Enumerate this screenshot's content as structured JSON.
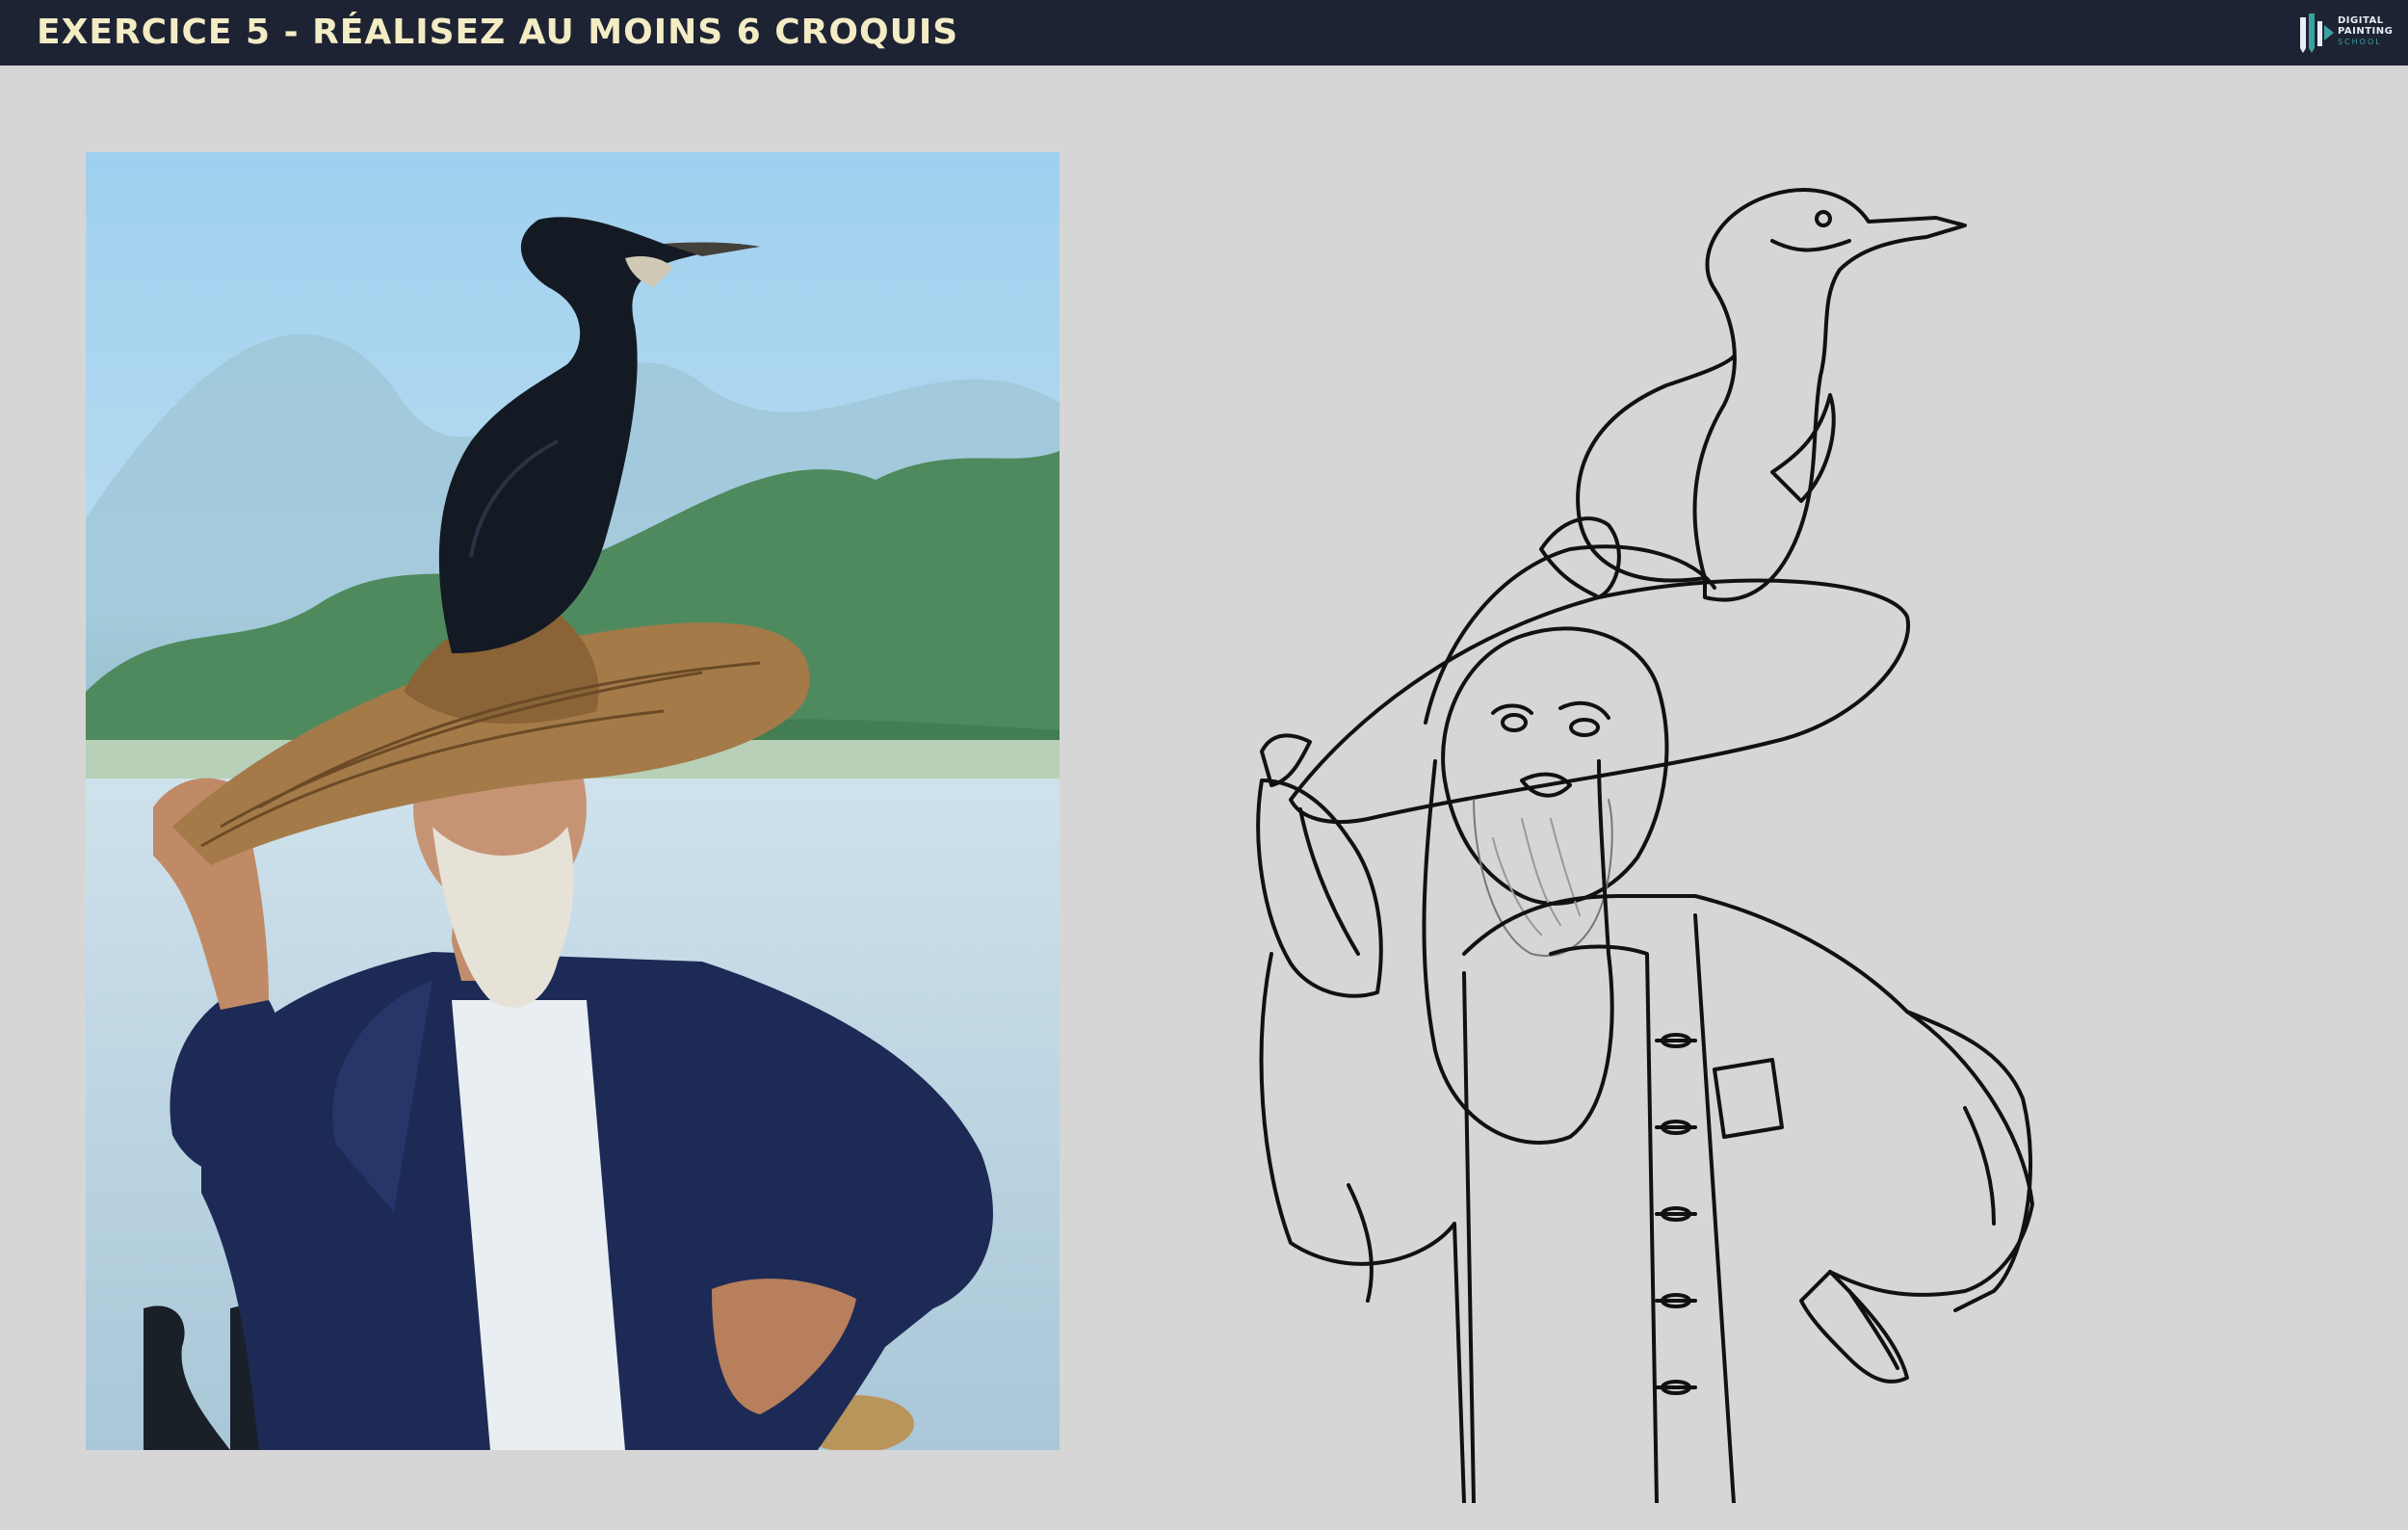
{
  "header": {
    "title": "EXERCICE 5 - RÉALISEZ AU MOINS 6 CROQUIS",
    "logo": {
      "line1": "DIGITAL",
      "line2": "PAINTING",
      "line3": "SCHOOL",
      "icon": "pencil-brush-logo-icon"
    }
  },
  "colors": {
    "header_bg": "#1d2333",
    "title_text": "#f4ecc4",
    "page_bg": "#d6d6d6",
    "logo_accent": "#3aa0a0"
  },
  "images": {
    "reference_photo": "old-fisherman-with-cormorant-on-straw-hat",
    "sketch": "line-drawing-of-fisherman-with-cormorant"
  }
}
